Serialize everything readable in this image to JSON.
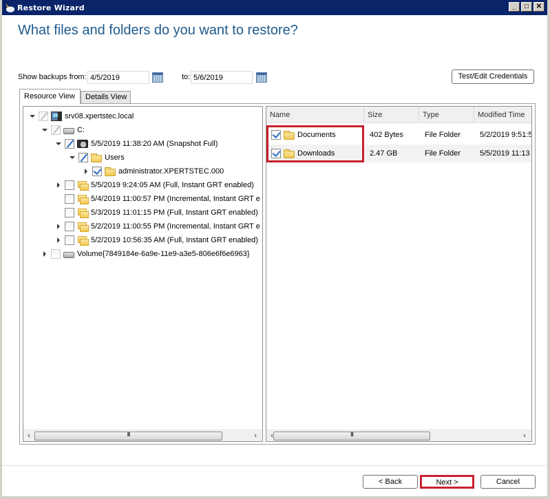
{
  "window": {
    "title": "Restore Wizard",
    "controls": {
      "minimize": "_",
      "maximize": "□",
      "close": "✕"
    }
  },
  "page": {
    "heading": "What files and folders do you want to restore?"
  },
  "filters": {
    "from_label": "Show backups from:",
    "from_value": "4/5/2019",
    "to_label": "to:",
    "to_value": "5/6/2019",
    "calendar_icon": "calendar-icon"
  },
  "credentials_button": "Test/Edit Credentials",
  "tabs": [
    {
      "label": "Resource View",
      "active": true
    },
    {
      "label": "Details View",
      "active": false
    }
  ],
  "tree": [
    {
      "label": "srv08.xpertstec.local",
      "level": 0,
      "expander": "open",
      "check": "partial-dim",
      "icon": "server-icon"
    },
    {
      "label": "C:",
      "level": 1,
      "expander": "open",
      "check": "partial-dim",
      "icon": "drive-icon"
    },
    {
      "label": "5/5/2019 11:38:20 AM (Snapshot Full)",
      "level": 2,
      "expander": "open",
      "check": "partial",
      "icon": "snapshot-icon"
    },
    {
      "label": "Users",
      "level": 3,
      "expander": "open",
      "check": "partial",
      "icon": "folder-icon"
    },
    {
      "label": "administrator.XPERTSTEC.000",
      "level": 4,
      "expander": "closed",
      "check": "checked",
      "icon": "folder-icon"
    },
    {
      "label": "5/5/2019 9:24:05 AM (Full, Instant GRT enabled)",
      "level": 2,
      "expander": "closed",
      "check": "none",
      "icon": "backup-set-icon"
    },
    {
      "label": "5/4/2019 11:00:57 PM (Incremental, Instant GRT e",
      "level": 2,
      "expander": "none",
      "check": "none",
      "icon": "backup-set-icon"
    },
    {
      "label": "5/3/2019 11:01:15 PM (Full, Instant GRT enabled)",
      "level": 2,
      "expander": "none",
      "check": "none",
      "icon": "backup-set-icon"
    },
    {
      "label": "5/2/2019 11:00:55 PM (Incremental, Instant GRT e",
      "level": 2,
      "expander": "closed",
      "check": "none",
      "icon": "backup-set-icon"
    },
    {
      "label": "5/2/2019 10:56:35 AM (Full, Instant GRT enabled)",
      "level": 2,
      "expander": "closed",
      "check": "none",
      "icon": "backup-set-icon"
    },
    {
      "label": "Volume{7849184e-6a9e-11e9-a3e5-806e6f6e6963}",
      "level": 1,
      "expander": "closed",
      "check": "none-dim",
      "icon": "volume-icon"
    }
  ],
  "file_list": {
    "columns": [
      "Name",
      "Size",
      "Type",
      "Modified Time"
    ],
    "rows": [
      {
        "name": "Documents",
        "size": "402 Bytes",
        "type": "File Folder",
        "modified": "5/2/2019 9:51:5",
        "checked": true
      },
      {
        "name": "Downloads",
        "size": "2.47 GB",
        "type": "File Folder",
        "modified": "5/5/2019 11:13",
        "checked": true
      }
    ]
  },
  "highlight_color": "#c8202f",
  "buttons": {
    "back": "< Back",
    "next": "Next >",
    "cancel": "Cancel"
  }
}
